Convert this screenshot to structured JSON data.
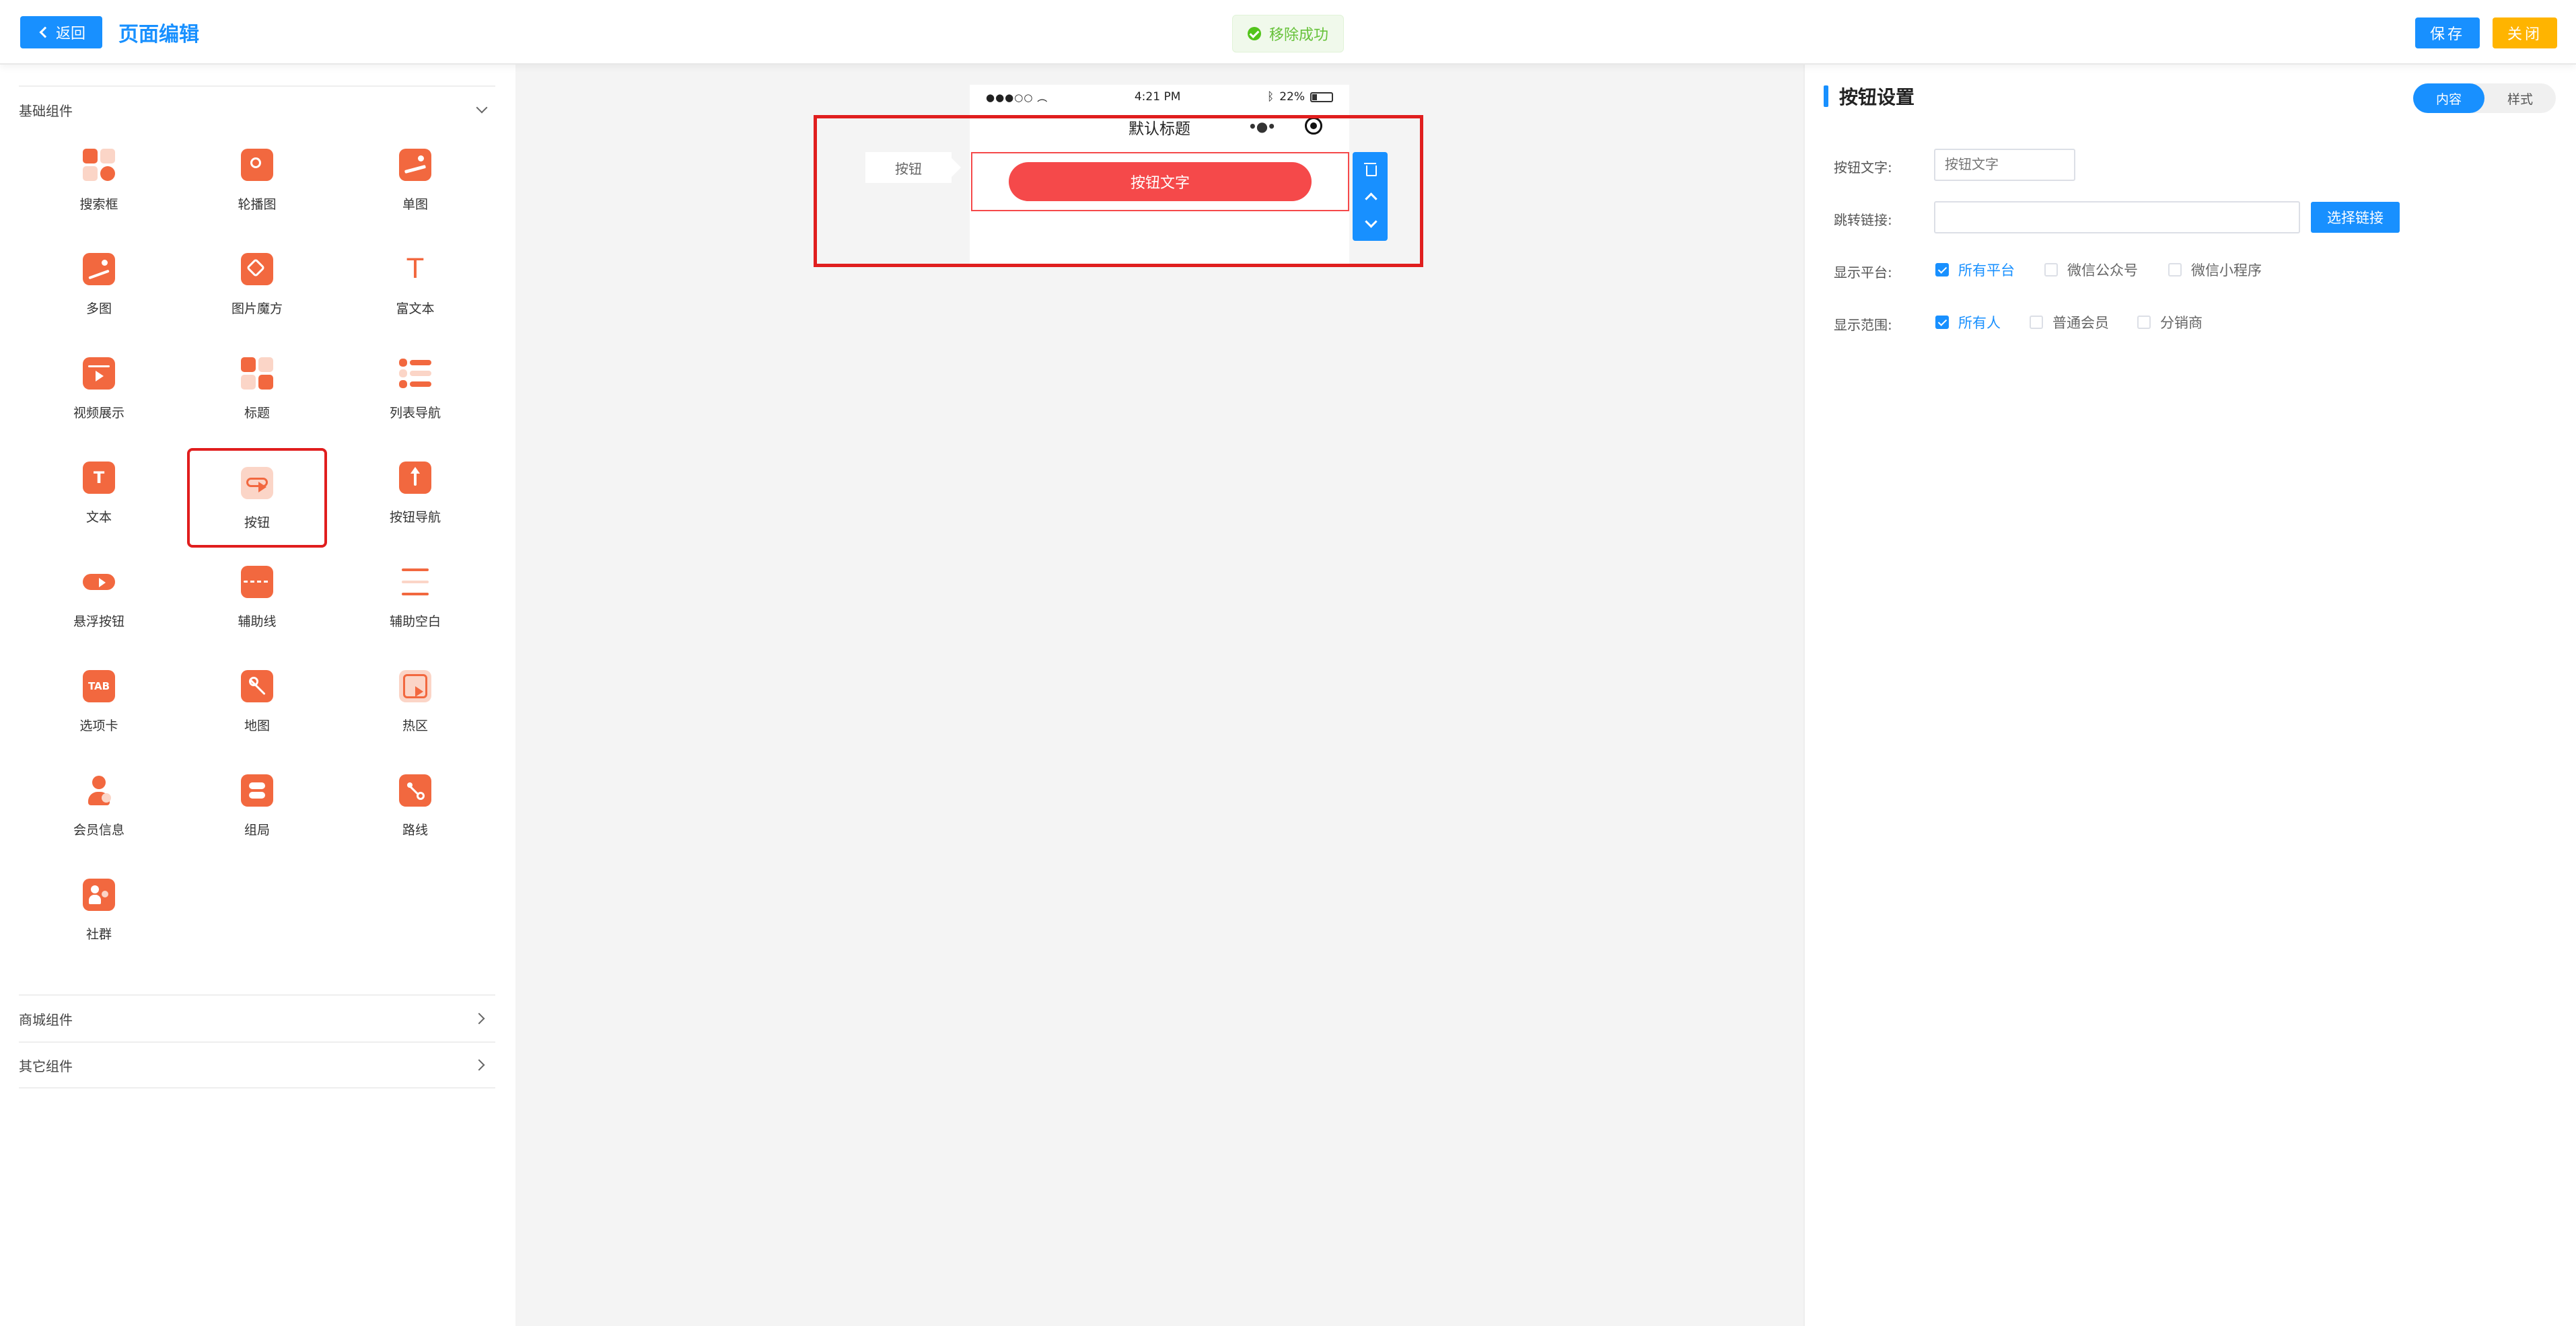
{
  "header": {
    "back_label": "返回",
    "title": "页面编辑",
    "toast": "移除成功",
    "save_label": "保存",
    "close_label": "关闭"
  },
  "left_panel": {
    "sections": [
      {
        "label": "基础组件",
        "expanded": true
      },
      {
        "label": "商城组件",
        "expanded": false
      },
      {
        "label": "其它组件",
        "expanded": false
      }
    ],
    "components": [
      {
        "label": "搜索框",
        "icon": "search-box-icon"
      },
      {
        "label": "轮播图",
        "icon": "carousel-icon"
      },
      {
        "label": "单图",
        "icon": "single-image-icon"
      },
      {
        "label": "多图",
        "icon": "multi-image-icon"
      },
      {
        "label": "图片魔方",
        "icon": "image-cube-icon"
      },
      {
        "label": "富文本",
        "icon": "rich-text-icon"
      },
      {
        "label": "视频展示",
        "icon": "video-icon"
      },
      {
        "label": "标题",
        "icon": "title-icon"
      },
      {
        "label": "列表导航",
        "icon": "list-nav-icon"
      },
      {
        "label": "文本",
        "icon": "text-icon"
      },
      {
        "label": "按钮",
        "icon": "button-icon",
        "selected": true
      },
      {
        "label": "按钮导航",
        "icon": "button-nav-icon"
      },
      {
        "label": "悬浮按钮",
        "icon": "float-button-icon"
      },
      {
        "label": "辅助线",
        "icon": "guide-line-icon"
      },
      {
        "label": "辅助空白",
        "icon": "blank-space-icon"
      },
      {
        "label": "选项卡",
        "icon": "tab-icon",
        "icon_text": "TAB"
      },
      {
        "label": "地图",
        "icon": "map-icon"
      },
      {
        "label": "热区",
        "icon": "hotspot-icon"
      },
      {
        "label": "会员信息",
        "icon": "member-info-icon"
      },
      {
        "label": "组局",
        "icon": "group-icon"
      },
      {
        "label": "路线",
        "icon": "route-icon"
      },
      {
        "label": "社群",
        "icon": "community-icon"
      }
    ]
  },
  "canvas": {
    "status_bar": {
      "signal": "●●●○○",
      "time": "4:21 PM",
      "battery": "22%"
    },
    "nav_title": "默认标题",
    "nav_menu": "•●•",
    "component_tag": "按钮",
    "button_text": "按钮文字"
  },
  "right_panel": {
    "title": "按钮设置",
    "tabs": [
      {
        "label": "内容",
        "active": true
      },
      {
        "label": "样式",
        "active": false
      }
    ],
    "fields": {
      "button_text_label": "按钮文字:",
      "button_text_placeholder": "按钮文字",
      "link_label": "跳转链接:",
      "link_value": "",
      "choose_link_label": "选择链接",
      "platform_label": "显示平台:",
      "platforms": [
        {
          "label": "所有平台",
          "checked": true
        },
        {
          "label": "微信公众号",
          "checked": false
        },
        {
          "label": "微信小程序",
          "checked": false
        }
      ],
      "scope_label": "显示范围:",
      "scopes": [
        {
          "label": "所有人",
          "checked": true
        },
        {
          "label": "普通会员",
          "checked": false
        },
        {
          "label": "分销商",
          "checked": false
        }
      ]
    }
  },
  "colors": {
    "primary": "#1890ff",
    "close": "#ffb400",
    "icon": "#f2683f",
    "button_red": "#f5494a",
    "selection_red": "#e01e1e",
    "success": "#67c23a"
  }
}
